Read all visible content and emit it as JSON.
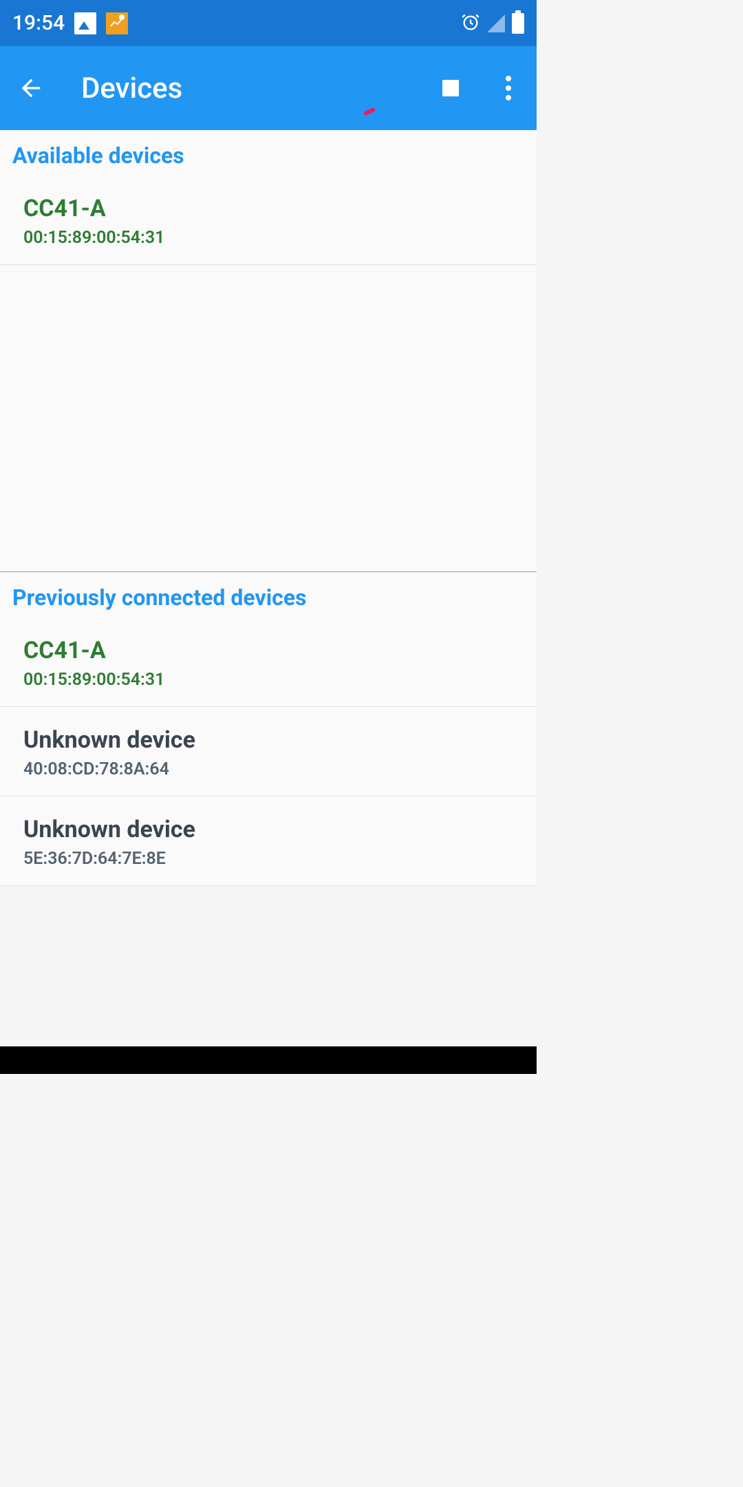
{
  "status_bar": {
    "time": "19:54"
  },
  "app_bar": {
    "title": "Devices"
  },
  "sections": {
    "available": {
      "header": "Available devices",
      "items": [
        {
          "name": "CC41-A",
          "address": "00:15:89:00:54:31",
          "color": "green"
        }
      ]
    },
    "previous": {
      "header": "Previously connected devices",
      "items": [
        {
          "name": "CC41-A",
          "address": "00:15:89:00:54:31",
          "color": "green"
        },
        {
          "name": "Unknown device",
          "address": "40:08:CD:78:8A:64",
          "color": "gray"
        },
        {
          "name": "Unknown device",
          "address": "5E:36:7D:64:7E:8E",
          "color": "gray"
        }
      ]
    }
  }
}
